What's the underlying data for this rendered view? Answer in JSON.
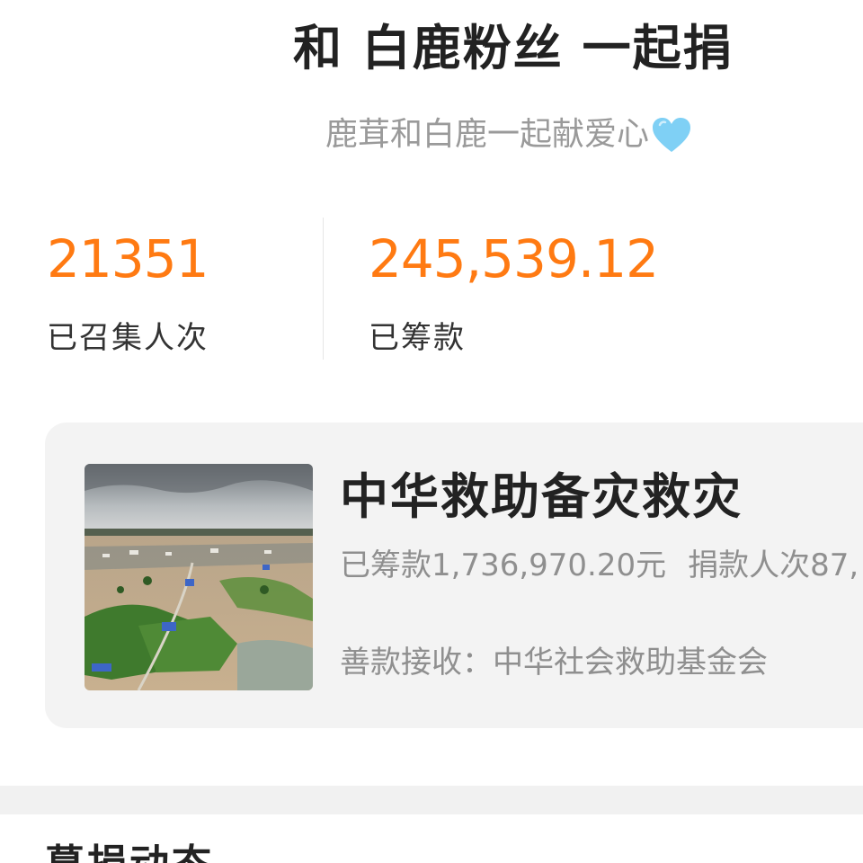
{
  "header": {
    "title": "和 白鹿粉丝 一起捐",
    "subtitle": "鹿茸和白鹿一起献爱心"
  },
  "stats": [
    {
      "value": "21351",
      "label": "已召集人次"
    },
    {
      "value": "245,539.12",
      "label": "已筹款"
    }
  ],
  "project": {
    "title": "中华救助备灾救灾",
    "raised_text": "已筹款1,736,970.20元",
    "donors_text": "捐款人次87,",
    "recipient_text": "善款接收：中华社会救助基金会",
    "image_icon": "flood-aerial-photo"
  },
  "section": {
    "heading": "募捐动态"
  },
  "colors": {
    "accent": "#ff7a12",
    "heart": "#7fd0f5",
    "card_bg": "#f3f3f3",
    "muted_text": "#8f8f8f"
  }
}
